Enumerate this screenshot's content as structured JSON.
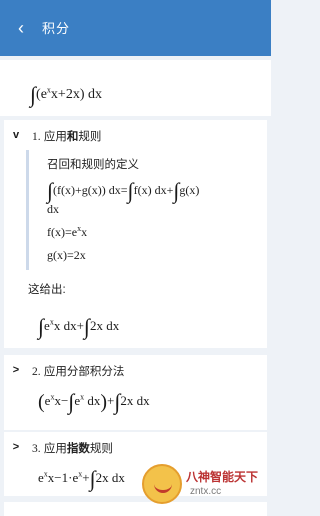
{
  "appbar": {
    "title": "积分",
    "back_icon": "back-arrow-icon"
  },
  "problem": {
    "expr_a": "(e",
    "expr_sup": "x",
    "expr_b": "x+2x) dx"
  },
  "sections": [
    {
      "num": "1.",
      "title_a": " 应用",
      "title_bold": "和",
      "title_b": "规则",
      "step_label": "召回和规则的定义",
      "step_eq1": "(f(x)+g(x)) dx=",
      "step_eq1_b": "f(x) dx+",
      "step_eq1_c": "g(x)",
      "step_dx": "dx",
      "step_eq2_a": "f(x)=e",
      "step_eq2_sup": "x",
      "step_eq2_b": "x",
      "step_eq3": "g(x)=2x",
      "gives": "这给出:",
      "result_a": "e",
      "result_sup": "x",
      "result_b": "x dx+",
      "result_c": "2x dx"
    },
    {
      "num": "2.",
      "title_a": " 应用分部积分法",
      "result_a": "e",
      "result_sup1": "x",
      "result_b": "x−",
      "result_c": "e",
      "result_sup2": "x",
      "result_d": " dx",
      "result_e": "+",
      "result_f": "2x dx"
    },
    {
      "num": "3.",
      "title_a": " 应用",
      "title_bold": "指数",
      "title_b": "规则",
      "result_a": "e",
      "result_sup1": "x",
      "result_b": "x−1·e",
      "result_sup2": "x",
      "result_c": "+",
      "result_d": "2x dx"
    }
  ],
  "watermark": {
    "text": "八神智能天下",
    "url": "zntx.cc"
  }
}
